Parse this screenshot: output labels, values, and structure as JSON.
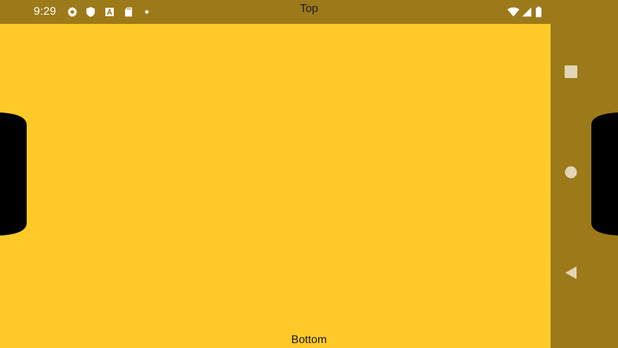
{
  "status_bar": {
    "time": "9:29",
    "left_icons": [
      "gear-icon",
      "shield-icon",
      "app-a-icon",
      "sd-card-icon",
      "dot-icon"
    ],
    "right_icons": [
      "wifi-icon",
      "cell-signal-icon",
      "battery-icon"
    ],
    "color": "#9C7A1A"
  },
  "labels": {
    "top": "Top",
    "bottom": "Bottom"
  },
  "content": {
    "background": "#FFCA28"
  },
  "nav_bar": {
    "buttons": [
      "recents-icon",
      "home-icon",
      "back-icon"
    ],
    "icon_color": "#E3D5B8"
  }
}
